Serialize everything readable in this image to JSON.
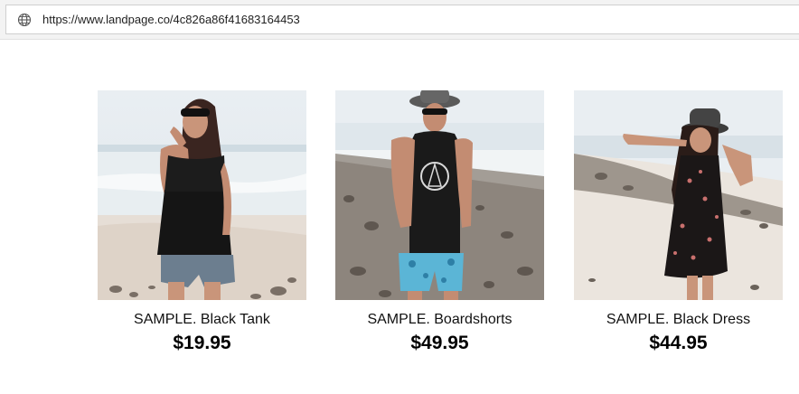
{
  "browser": {
    "url": "https://www.landpage.co/4c826a86f41683164453",
    "site_icon": "globe-icon"
  },
  "products": [
    {
      "name": "SAMPLE. Black Tank",
      "price": "$19.95",
      "image": "woman-black-tank-beach-photo"
    },
    {
      "name": "SAMPLE. Boardshorts",
      "price": "$49.95",
      "image": "man-boardshorts-beach-photo"
    },
    {
      "name": "SAMPLE. Black Dress",
      "price": "$44.95",
      "image": "woman-black-dress-beach-photo"
    }
  ]
}
